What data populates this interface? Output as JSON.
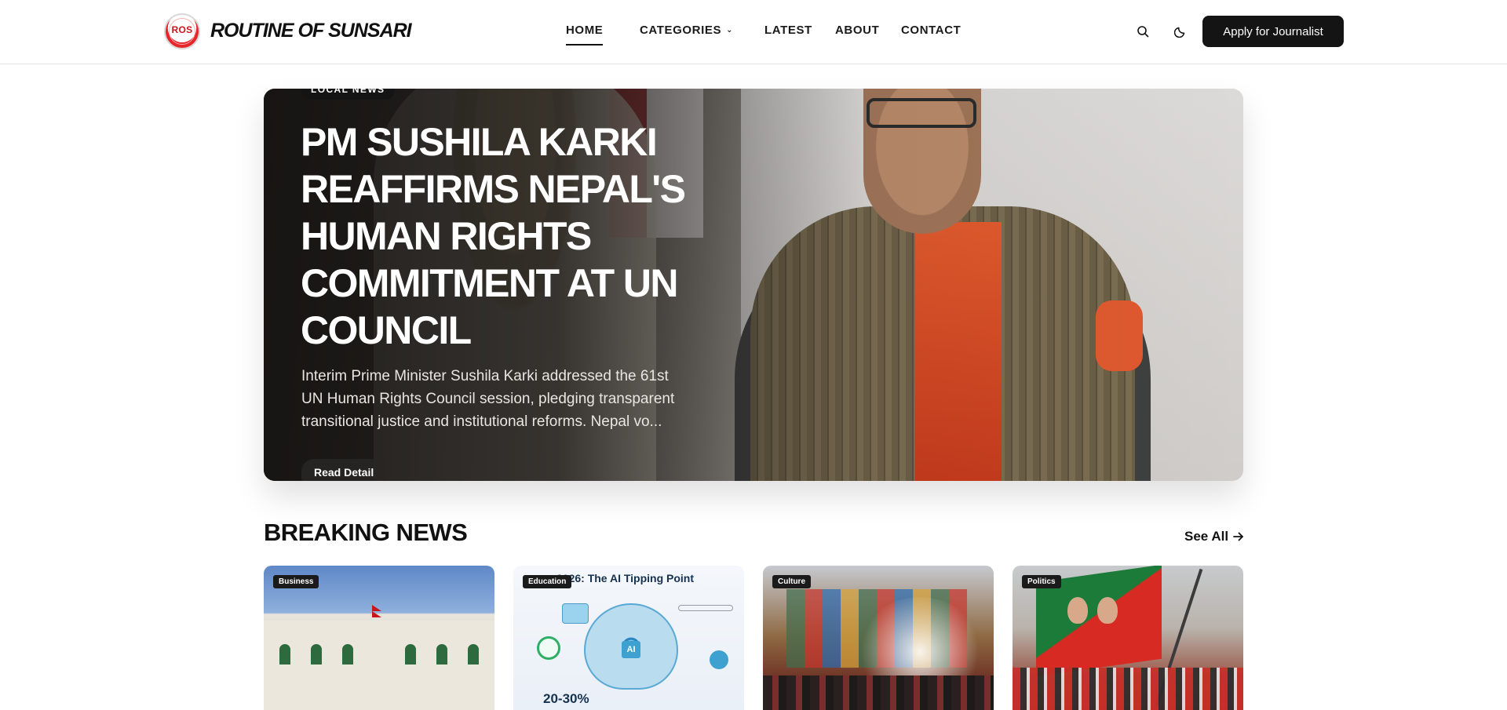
{
  "header": {
    "logo_text": "ROS",
    "site_title": "ROUTINE OF SUNSARI",
    "nav": {
      "home": "HOME",
      "categories": "CATEGORIES",
      "latest": "LATEST",
      "about": "ABOUT",
      "contact": "CONTACT"
    },
    "apply_label": "Apply for Journalist",
    "icons": [
      "search-icon",
      "moon-icon",
      "chevron-down-icon"
    ]
  },
  "hero": {
    "tag": "LOCAL NEWS",
    "title": "PM SUSHILA KARKI REAFFIRMS NEPAL'S HUMAN RIGHTS COMMITMENT AT UN COUNCIL",
    "description": "Interim Prime Minister Sushila Karki addressed the 61st UN Human Rights Council session, pledging transparent transitional justice and institutional reforms. Nepal vo...",
    "button_label": "Read Detail"
  },
  "breaking": {
    "title": "BREAKING NEWS",
    "see_all_label": "See All",
    "cards": [
      {
        "tag": "Business"
      },
      {
        "tag": "Education",
        "image_text_title": "2026: The AI Tipping Point",
        "image_text_core": "AI",
        "image_text_stat": "20-30%"
      },
      {
        "tag": "Culture"
      },
      {
        "tag": "Politics"
      }
    ]
  },
  "colors": {
    "primary_dark": "#141414",
    "accent_red": "#c8161d",
    "text": "#111111"
  }
}
